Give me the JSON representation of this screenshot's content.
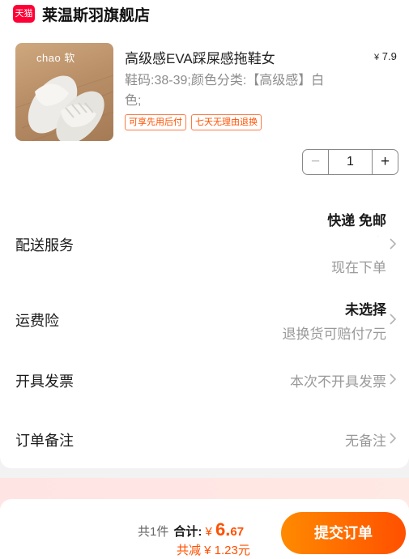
{
  "store": {
    "badge": "天猫",
    "name": "莱温斯羽旗舰店"
  },
  "product": {
    "image_caption": "chao  软",
    "title": "高级感EVA踩屎感拖鞋女",
    "price_currency": "¥",
    "price": "7.9",
    "spec": "鞋码:38-39;颜色分类:【高级感】白色;",
    "tags": [
      "可享先用后付",
      "七天无理由退换"
    ],
    "quantity": "1",
    "minus_symbol": "−",
    "plus_symbol": "+"
  },
  "rows": {
    "delivery": {
      "label": "配送服务",
      "value": "快递 免邮",
      "note": "现在下单"
    },
    "insurance": {
      "label": "运费险",
      "value": "未选择",
      "note": "退换货可赔付7元"
    },
    "invoice": {
      "label": "开具发票",
      "value": "本次不开具发票"
    },
    "remark": {
      "label": "订单备注",
      "value": "无备注"
    }
  },
  "footer": {
    "count_text": "共1件",
    "total_label": "合计:",
    "total_currency": "¥",
    "total_int": "6.",
    "total_dec": "67",
    "discount_text": "共减 ¥ 1.23元",
    "submit_label": "提交订单"
  },
  "colors": {
    "accent": "#ff5000",
    "tmall_red": "#ff0036"
  }
}
